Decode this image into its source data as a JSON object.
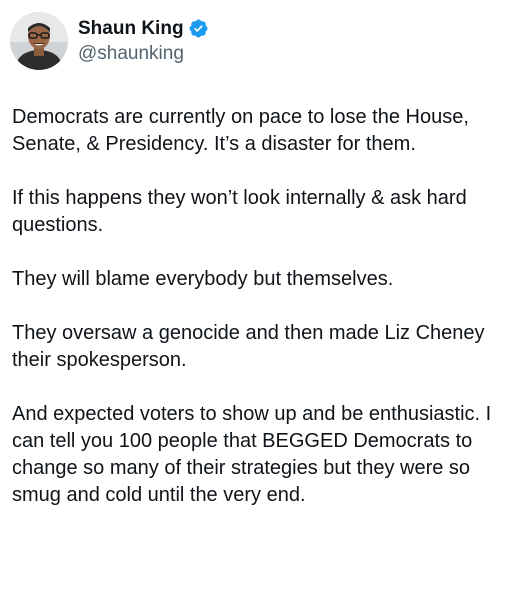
{
  "author": {
    "display_name": "Shaun King",
    "handle": "@shaunking",
    "verified": true,
    "verified_color": "#1d9bf0",
    "avatar_icon": "profile-photo"
  },
  "tweet": {
    "paragraphs": [
      "Democrats are currently on pace to lose the House, Senate, & Presidency. It’s a disaster for them.",
      "If this happens they won’t look internally & ask hard questions.",
      "They will blame everybody but themselves.",
      "They oversaw a genocide and then made Liz Cheney their spokesperson.",
      "And expected voters to show up and be enthusiastic. I can tell you 100 people that BEGGED Democrats to change so many of their strategies but they were so smug and cold until the very end."
    ]
  }
}
